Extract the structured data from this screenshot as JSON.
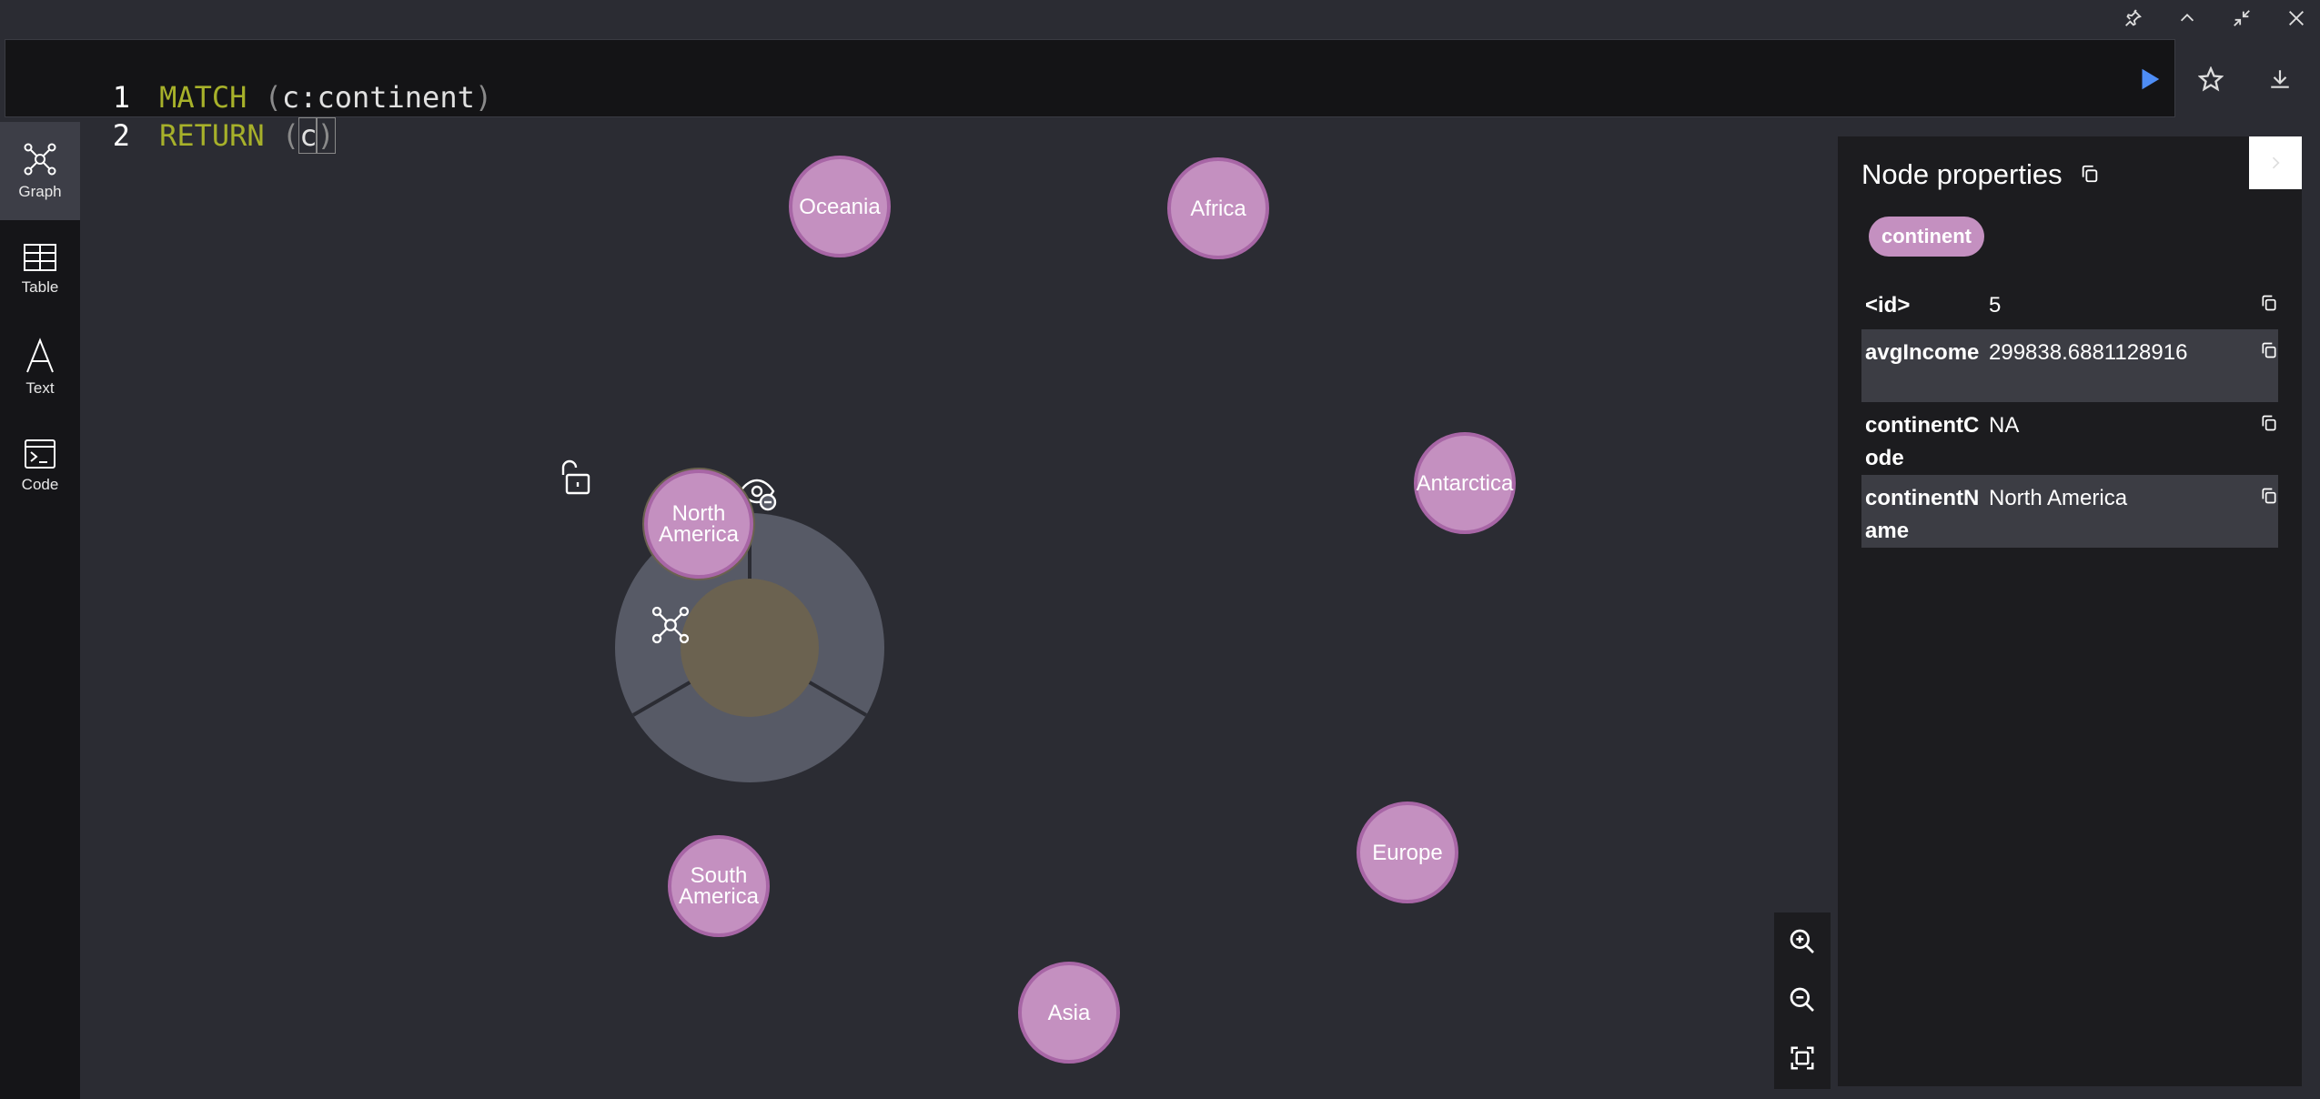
{
  "window_controls": [
    {
      "name": "pin-icon"
    },
    {
      "name": "chevron-up-icon"
    },
    {
      "name": "minimize-arrows-icon"
    },
    {
      "name": "close-icon"
    }
  ],
  "editor": {
    "lines": [
      {
        "num": "1",
        "keyword": "MATCH",
        "open": " (",
        "code": "c:continent",
        "close": ")"
      },
      {
        "num": "2",
        "keyword": "RETURN",
        "open": " (",
        "code": "c",
        "close": ")"
      }
    ]
  },
  "editor_actions": [
    {
      "name": "run-icon"
    },
    {
      "name": "star-icon"
    },
    {
      "name": "download-icon"
    }
  ],
  "sidebar": {
    "items": [
      {
        "label": "Graph",
        "icon": "graph-icon"
      },
      {
        "label": "Table",
        "icon": "table-icon"
      },
      {
        "label": "Text",
        "icon": "text-icon"
      },
      {
        "label": "Code",
        "icon": "code-icon"
      }
    ]
  },
  "graph": {
    "nodes": [
      {
        "label": "Oceania"
      },
      {
        "label": "Africa"
      },
      {
        "label": "Antarctica"
      },
      {
        "label": "North America"
      },
      {
        "label": "South America"
      },
      {
        "label": "Europe"
      },
      {
        "label": "Asia"
      }
    ],
    "selected_node": "North America",
    "ring_actions": [
      {
        "name": "unlock-icon"
      },
      {
        "name": "hide-icon"
      },
      {
        "name": "expand-graph-icon"
      }
    ]
  },
  "panel": {
    "title": "Node properties",
    "label_tag": "continent",
    "properties": [
      {
        "key": "<id>",
        "value": "5"
      },
      {
        "key": "avgIncome",
        "value": "299838.6881128916"
      },
      {
        "key": "continentCode",
        "value": "NA"
      },
      {
        "key": "continentName",
        "value": "North America"
      }
    ]
  },
  "zoom_controls": [
    {
      "name": "zoom-in-icon"
    },
    {
      "name": "zoom-out-icon"
    },
    {
      "name": "fit-screen-icon"
    }
  ],
  "colors": {
    "node_fill": "#c490c0",
    "node_border": "#a866a6",
    "keyword": "#a7b12a",
    "run": "#4e8df5",
    "background": "#2b2c33"
  }
}
